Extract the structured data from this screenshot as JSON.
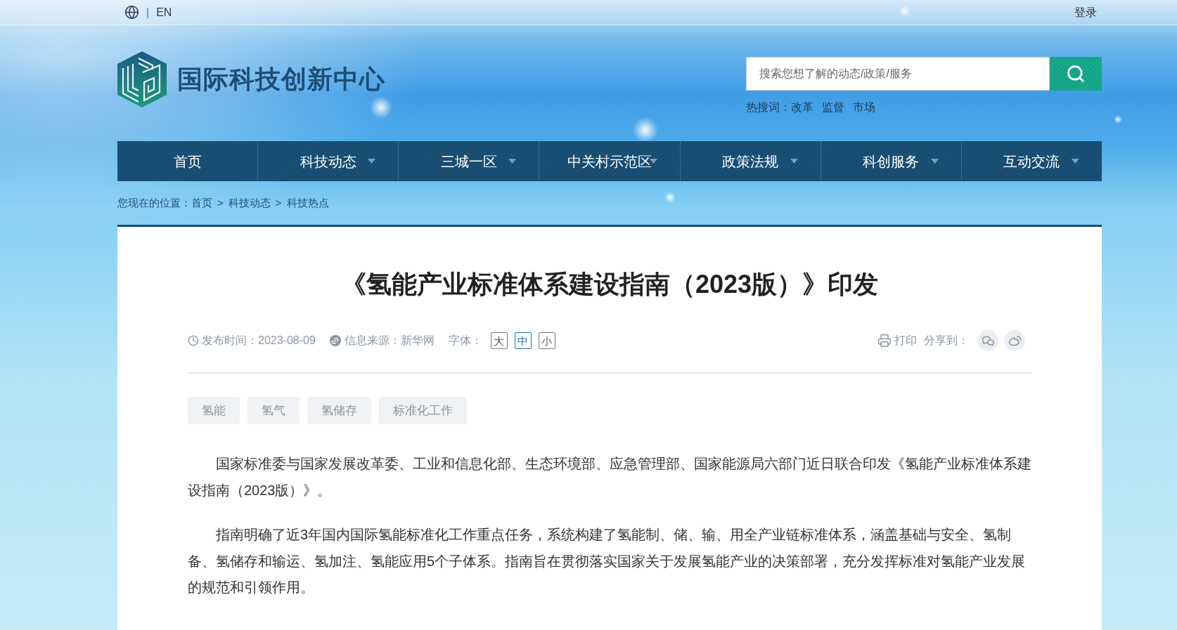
{
  "top_bar": {
    "language": "EN",
    "separator": "|",
    "login": "登录"
  },
  "header": {
    "logo_text": "国际科技创新中心",
    "search": {
      "placeholder": "搜索您想了解的动态/政策/服务"
    },
    "hot_search": {
      "label": "热搜词：",
      "words": [
        "改革",
        "监督",
        "市场"
      ]
    }
  },
  "nav": [
    {
      "label": "首页",
      "has_menu": false
    },
    {
      "label": "科技动态",
      "has_menu": true
    },
    {
      "label": "三城一区",
      "has_menu": true
    },
    {
      "label": "中关村示范区",
      "has_menu": true
    },
    {
      "label": "政策法规",
      "has_menu": true
    },
    {
      "label": "科创服务",
      "has_menu": true
    },
    {
      "label": "互动交流",
      "has_menu": true
    }
  ],
  "breadcrumb": {
    "label": "您现在的位置：",
    "parts": [
      {
        "kind": "link",
        "text": "首页"
      },
      {
        "kind": "separator",
        "text": ">"
      },
      {
        "kind": "link",
        "text": "科技动态"
      },
      {
        "kind": "separator",
        "text": ">"
      },
      {
        "kind": "link",
        "text": "科技热点"
      }
    ]
  },
  "article": {
    "title": "《氢能产业标准体系建设指南（2023版）》印发",
    "meta": {
      "published": "发布时间：2023-08-09",
      "source": "信息来源：新华网",
      "font_size_label": "字体：",
      "font_sizes": [
        {
          "label": "大",
          "selected": false
        },
        {
          "label": "中",
          "selected": true
        },
        {
          "label": "小",
          "selected": false
        }
      ],
      "print": "打印",
      "share_label": "分享到："
    },
    "tags": [
      "氢能",
      "氢气",
      "氢储存",
      "标准化工作"
    ],
    "paragraphs": [
      "国家标准委与国家发展改革委、工业和信息化部、生态环境部、应急管理部、国家能源局六部门近日联合印发《氢能产业标准体系建设指南（2023版）》。",
      "指南明确了近3年国内国际氢能标准化工作重点任务，系统构建了氢能制、储、输、用全产业链标准体系，涵盖基础与安全、氢制备、氢储存和输运、氢加注、氢能应用5个子体系。指南旨在贯彻落实国家关于发展氢能产业的决策部署，充分发挥标准对氢能产业发展的规范和引领作用。"
    ]
  }
}
